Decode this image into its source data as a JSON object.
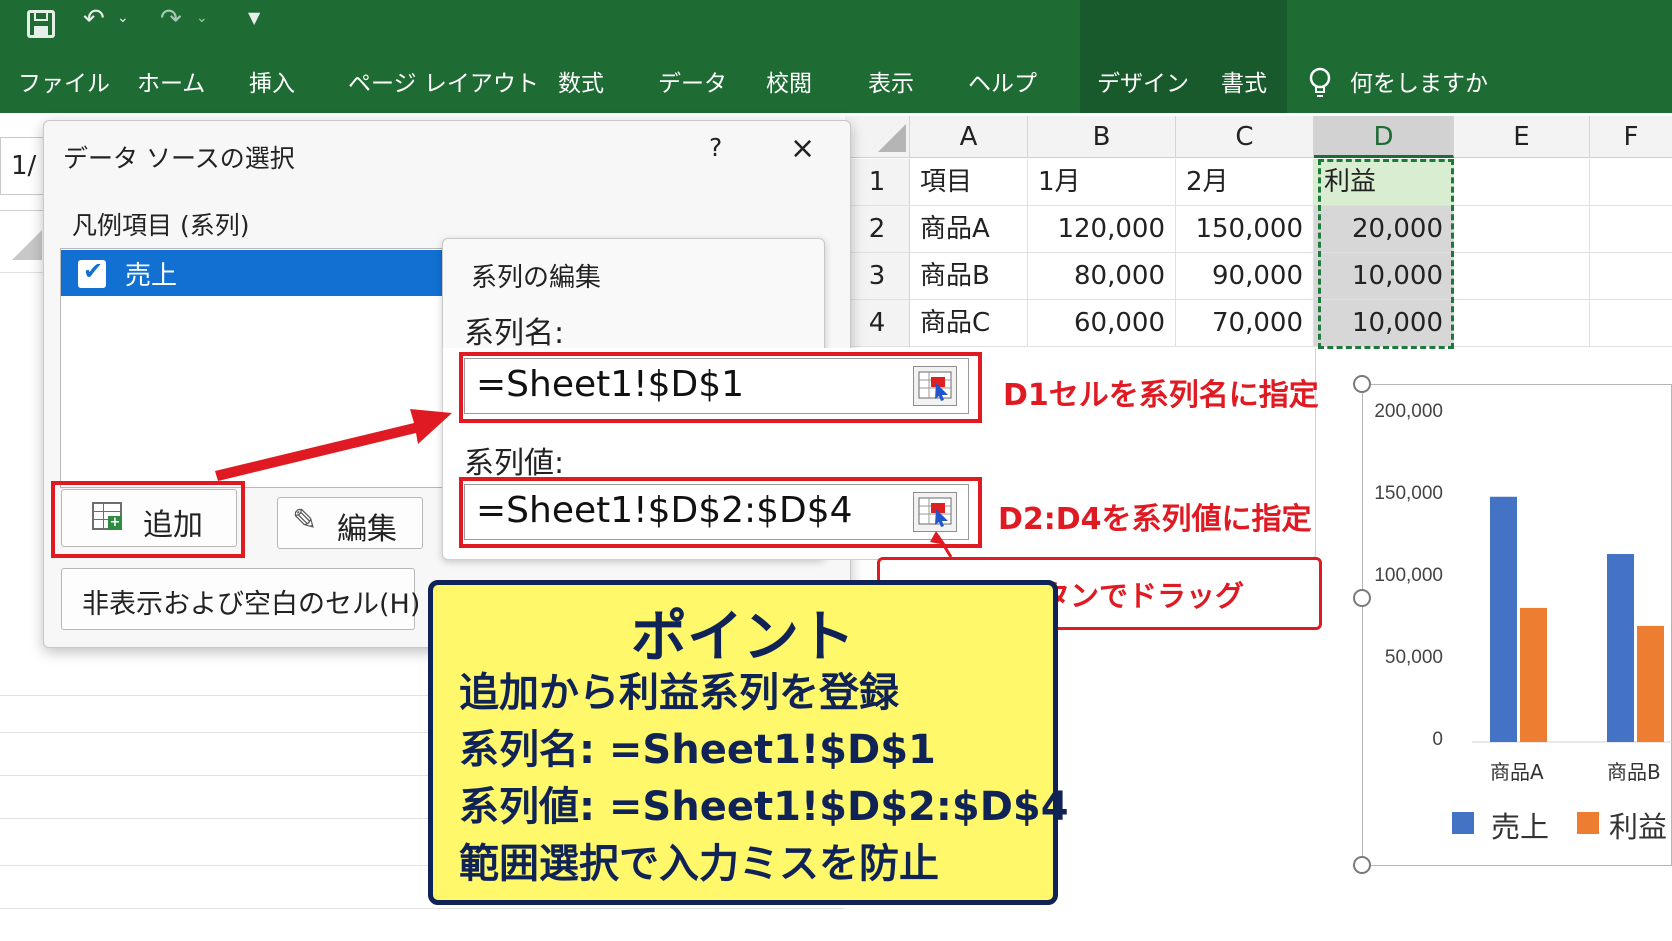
{
  "ribbon": {
    "tabs": [
      "ファイル",
      "ホーム",
      "挿入",
      "ページ レイアウト",
      "数式",
      "データ",
      "校閲",
      "表示",
      "ヘルプ",
      "デザイン",
      "書式"
    ],
    "tell_me": "何をしますか",
    "colors": {
      "ribbon": "#1e6b34",
      "contextual": "#185a2b"
    }
  },
  "qat": {
    "save_icon": "save-icon",
    "undo_icon": "undo-icon",
    "redo_icon": "redo-icon",
    "customize_icon": "chevron-down-icon"
  },
  "sheet": {
    "name_box_partial": "1/",
    "columns": [
      "A",
      "B",
      "C",
      "D",
      "E",
      "F"
    ],
    "rows": [
      {
        "num": "1",
        "a": "項目",
        "b": "1月",
        "c": "2月",
        "d": "利益"
      },
      {
        "num": "2",
        "a": "商品A",
        "b": "120,000",
        "c": "150,000",
        "d": "20,000"
      },
      {
        "num": "3",
        "a": "商品B",
        "b": "80,000",
        "c": "90,000",
        "d": "10,000"
      },
      {
        "num": "4",
        "a": "商品C",
        "b": "60,000",
        "c": "70,000",
        "d": "10,000"
      }
    ]
  },
  "data_source_dialog": {
    "title": "データ ソースの選択",
    "help": "?",
    "close": "×",
    "legend_label": "凡例項目 (系列)",
    "series_items": [
      "売上"
    ],
    "add_label": "追加",
    "edit_label": "編集",
    "hidden_cells_label": "非表示および空白のセル(H)"
  },
  "edit_series_dialog": {
    "title": "系列の編集",
    "name_label": "系列名:",
    "name_value": "=Sheet1!$D$1",
    "values_label": "系列値:",
    "values_value": "=Sheet1!$D$2:$D$4"
  },
  "annotations": {
    "name_note": "D1セルを系列名に指定",
    "values_note": "D2:D4を系列値に指定",
    "range_button_note": "範囲選択ボタンでドラッグ",
    "accent": "#e01a22"
  },
  "point_box": {
    "title": "ポイント",
    "lines": [
      "追加から利益系列を登録",
      "系列名: =Sheet1!$D$1",
      "系列値: =Sheet1!$D$2:$D$4",
      "範囲選択で入力ミスを防止"
    ],
    "bg": "#fff86a",
    "fg": "#0f2357"
  },
  "chart_data": {
    "type": "bar",
    "categories": [
      "商品A",
      "商品B"
    ],
    "series": [
      {
        "name": "売上",
        "values": [
          150000,
          115000
        ],
        "color": "#4472c4"
      },
      {
        "name": "利益",
        "values": [
          82000,
          71000
        ],
        "color": "#ed7d31"
      }
    ],
    "ylim": [
      0,
      200000
    ],
    "yticks": [
      "200,000",
      "150,000",
      "100,000",
      "50,000",
      "0"
    ],
    "legend": "bottom"
  }
}
